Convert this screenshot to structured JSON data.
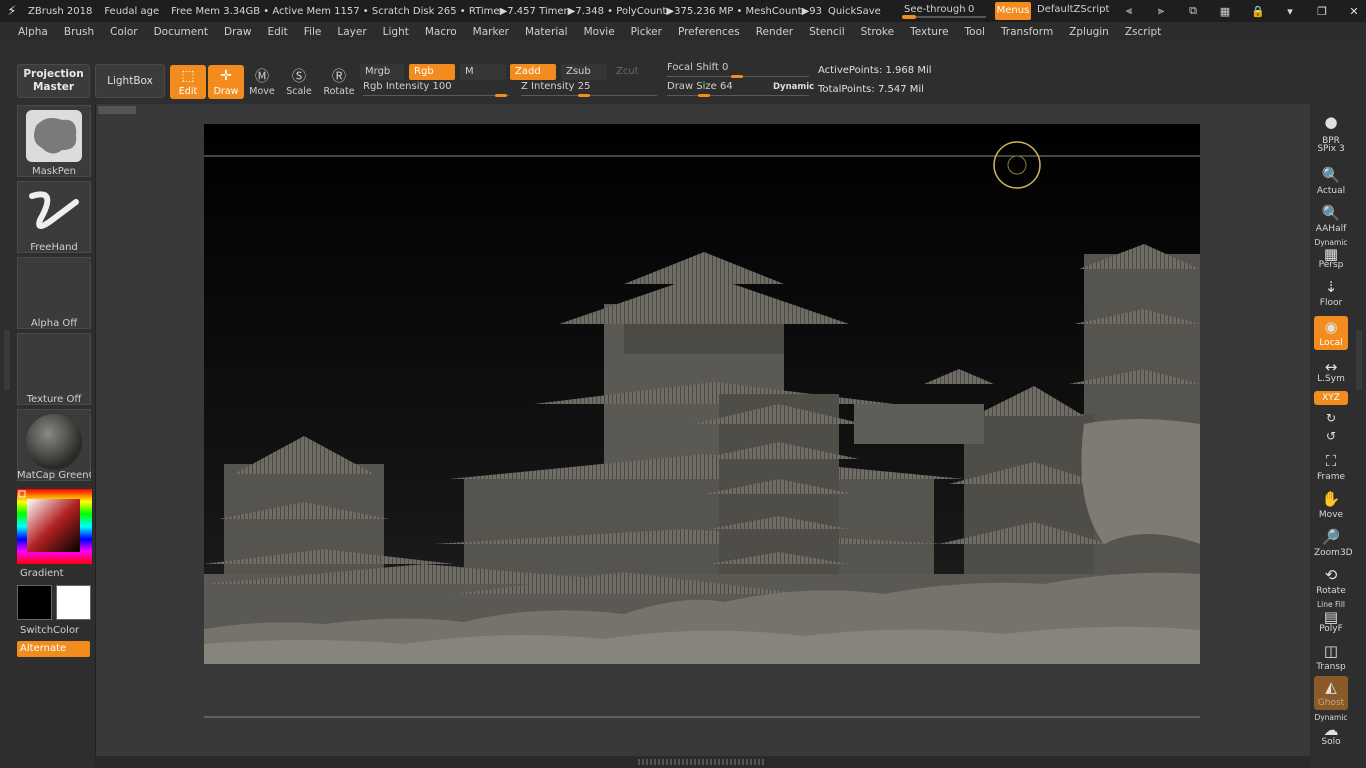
{
  "title_bar": {
    "app": "ZBrush 2018",
    "document": "Feudal age",
    "memory": "Free Mem 3.34GB • Active Mem 1157 • Scratch Disk 265 • RTime▶7.457 Timer▶7.348 • PolyCount▶375.236 MP • MeshCount▶93",
    "quicksave": "QuickSave",
    "see_through_label": "See-through",
    "see_through_value": "0",
    "menus": "Menus",
    "default_script": "DefaultZScript"
  },
  "menu": [
    "Alpha",
    "Brush",
    "Color",
    "Document",
    "Draw",
    "Edit",
    "File",
    "Layer",
    "Light",
    "Macro",
    "Marker",
    "Material",
    "Movie",
    "Picker",
    "Preferences",
    "Render",
    "Stencil",
    "Stroke",
    "Texture",
    "Tool",
    "Transform",
    "Zplugin",
    "Zscript"
  ],
  "toolbar": {
    "projection_master": "Projection Master",
    "lightbox": "LightBox",
    "edit": "Edit",
    "draw": "Draw",
    "move": "Move",
    "scale": "Scale",
    "rotate": "Rotate",
    "mrgb": "Mrgb",
    "rgb": "Rgb",
    "m": "M",
    "zadd": "Zadd",
    "zsub": "Zsub",
    "zcut": "Zcut",
    "rgb_intensity_label": "Rgb Intensity",
    "rgb_intensity_value": "100",
    "z_intensity_label": "Z Intensity",
    "z_intensity_value": "25",
    "focal_shift_label": "Focal Shift",
    "focal_shift_value": "0",
    "draw_size_label": "Draw Size",
    "draw_size_value": "64",
    "dynamic": "Dynamic",
    "active_points": "ActivePoints: 1.968 Mil",
    "total_points": "TotalPoints: 7.547 Mil"
  },
  "left_panel": {
    "brush": "MaskPen",
    "stroke": "FreeHand",
    "alpha": "Alpha Off",
    "texture": "Texture Off",
    "material": "MatCap GreenC",
    "gradient": "Gradient",
    "switchcolor": "SwitchColor",
    "alternate": "Alternate"
  },
  "right_shelf": {
    "bpr": "BPR",
    "spix": "SPix 3",
    "actual": "Actual",
    "aahalf": "AAHalf",
    "dynamic": "Dynamic",
    "persp": "Persp",
    "floor": "Floor",
    "local": "Local",
    "lsym": "L.Sym",
    "xyz": "XYZ",
    "frame": "Frame",
    "move": "Move",
    "zoom3d": "Zoom3D",
    "rotate": "Rotate",
    "line_fill": "Line Fill",
    "polyf": "PolyF",
    "transp": "Transp",
    "ghost": "Ghost",
    "dynamic2": "Dynamic",
    "solo": "Solo"
  },
  "colors": {
    "accent": "#f28c1e",
    "bg": "#2e2e2e",
    "model": "#7c7a72"
  }
}
